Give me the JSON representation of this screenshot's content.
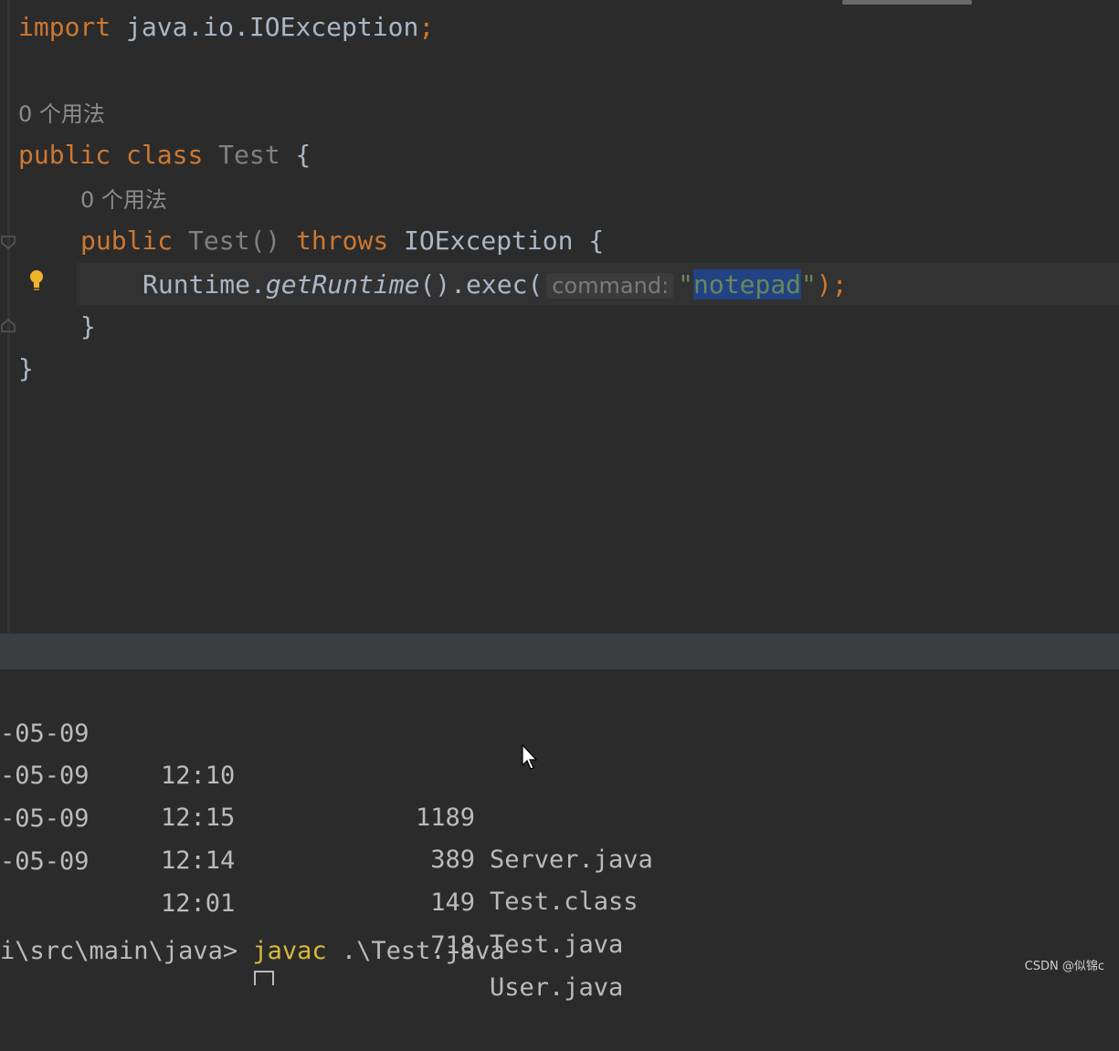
{
  "editor": {
    "import_kw": "import",
    "import_path": " java.io.IOException",
    "import_semicolon": ";",
    "usage_1": "0 个用法",
    "class_kw1": "public",
    "class_kw2": "class",
    "class_name": "Test",
    "class_brace": " {",
    "usage_2": "0 个用法",
    "ctor_kw": "public",
    "ctor_name": "Test()",
    "ctor_throws": "throws",
    "ctor_exc": "IOException {",
    "call_prefix": "Runtime.",
    "call_method": "getRuntime",
    "call_mid": "().exec(",
    "param_hint": "command:",
    "str_open": "\"",
    "str_value": "notepad",
    "str_close": "\"",
    "call_end": ");",
    "close_inner": "}",
    "close_outer": "}"
  },
  "terminal": {
    "rows": [
      {
        "date": "-05-09",
        "time": "12:10",
        "size": "1189",
        "name": "Server.java"
      },
      {
        "date": "-05-09",
        "time": "12:15",
        "size": "389",
        "name": "Test.class"
      },
      {
        "date": "-05-09",
        "time": "12:14",
        "size": "149",
        "name": "Test.java"
      },
      {
        "date": "-05-09",
        "time": "12:01",
        "size": "718",
        "name": "User.java"
      }
    ],
    "prompt_path": "i\\src\\main\\java> ",
    "command": "javac",
    "command_arg": " .\\Test.java"
  },
  "watermark": "CSDN @似锦c",
  "icons": [
    "fold-icon",
    "bulb-icon",
    "mouse-pointer-icon"
  ],
  "colors": {
    "keyword": "#cc7832",
    "string": "#6a8759",
    "selection": "#214283",
    "command": "#d7ba3d"
  }
}
